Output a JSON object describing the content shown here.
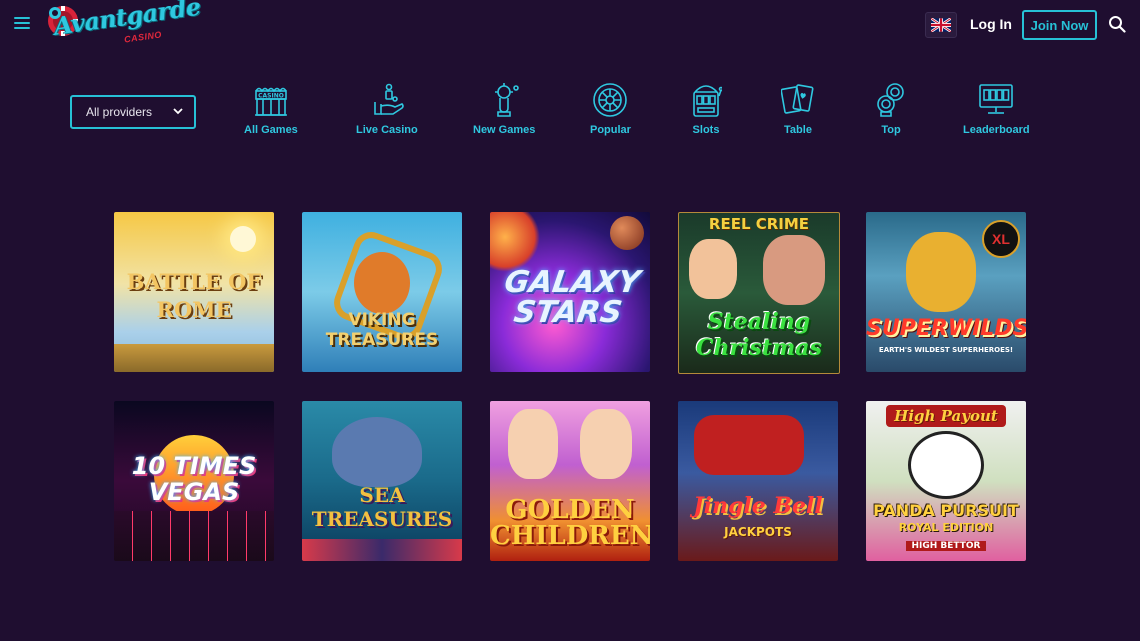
{
  "header": {
    "logo_text": "Avantgarde",
    "logo_sub": "CASINO",
    "login_label": "Log In",
    "join_label": "Join Now"
  },
  "icons": {
    "menu": "hamburger-menu-icon",
    "flag": "uk-flag-icon",
    "search": "search-icon"
  },
  "filters": {
    "provider_select": "All providers",
    "categories": [
      {
        "label": "All Games",
        "icon": "casino-building-icon"
      },
      {
        "label": "Live Casino",
        "icon": "dealer-hand-icon"
      },
      {
        "label": "New Games",
        "icon": "new-games-icon"
      },
      {
        "label": "Popular",
        "icon": "roulette-wheel-icon"
      },
      {
        "label": "Slots",
        "icon": "slot-machine-icon"
      },
      {
        "label": "Table",
        "icon": "playing-cards-icon"
      },
      {
        "label": "Top",
        "icon": "top-chips-icon"
      },
      {
        "label": "Leaderboard",
        "icon": "leaderboard-monitor-icon"
      }
    ]
  },
  "games": [
    {
      "title": "Battle of Rome",
      "art_text": "BATTLE OF ROME"
    },
    {
      "title": "Viking Treasures",
      "art_text": "VIKING TREASURES"
    },
    {
      "title": "Galaxy Stars",
      "art_text": "GALAXY STARS"
    },
    {
      "title": "Stealing Christmas",
      "art_text_top": "REEL CRIME",
      "art_text": "Stealing Christmas"
    },
    {
      "title": "Super Wilds",
      "art_text": "SUPERWILDS",
      "art_sub": "EARTH'S WILDEST SUPERHEROES!",
      "badge": "XL"
    },
    {
      "title": "10 Times Vegas",
      "art_text": "10 TIMES VEGAS"
    },
    {
      "title": "Sea Treasures",
      "art_text": "SEA TREASURES"
    },
    {
      "title": "Golden Children",
      "art_text": "GOLDEN CHILDREN"
    },
    {
      "title": "Jingle Bell Jackpots",
      "art_text": "Jingle Bell",
      "art_sub": "JACKPOTS"
    },
    {
      "title": "Panda Pursuit Royal Edition",
      "art_text_top": "High Payout",
      "art_text": "PANDA PURSUIT",
      "art_sub": "ROYAL EDITION",
      "art_sub2": "HIGH BETTOR"
    }
  ],
  "colors": {
    "background": "#1f0e30",
    "accent": "#27c1d6",
    "brand_red": "#e0283c"
  }
}
